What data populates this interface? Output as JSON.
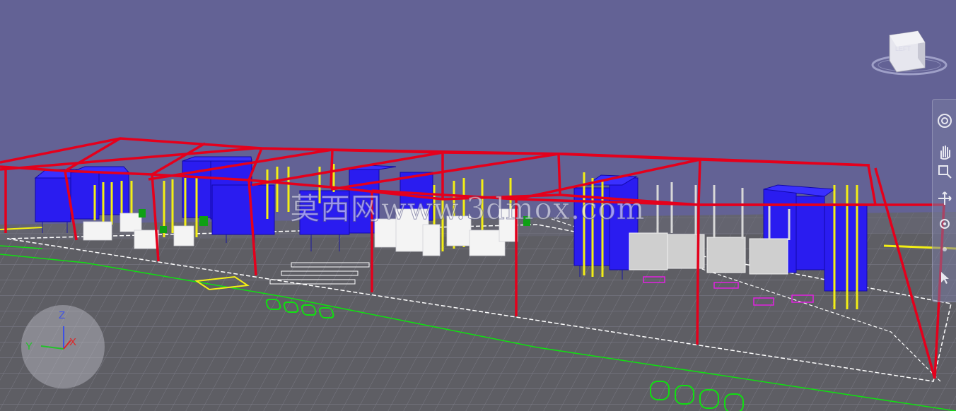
{
  "viewport": {
    "watermark_text": "莫西网www.3dmox.com",
    "colors": {
      "background": "#636295",
      "floor": "#5e5e64",
      "grid": "#7d7d88",
      "frame": "#e4001c",
      "dust_collector": "#2a1cf0",
      "elevator": "#f3ef14",
      "machine": "#ffffff",
      "outline": "#ffffff",
      "green_mark": "#10e010"
    }
  },
  "viewcube": {
    "face_label": "LEFT",
    "icon": "viewcube-icon"
  },
  "navigation_bar": {
    "tools": [
      {
        "name": "orbit-wheel",
        "icon": "steering-wheel-icon"
      },
      {
        "name": "pan",
        "icon": "hand-icon"
      },
      {
        "name": "zoom",
        "icon": "zoom-window-icon"
      },
      {
        "name": "orbit",
        "icon": "orbit-icon"
      },
      {
        "name": "look",
        "icon": "look-icon"
      },
      {
        "name": "walk",
        "icon": "walk-icon"
      },
      {
        "name": "select",
        "icon": "cursor-icon"
      }
    ]
  },
  "axis_gizmo": {
    "z_label": "Z",
    "y_label": "Y",
    "x_label": "X",
    "z_color": "#3c50e6",
    "y_color": "#22c22a",
    "x_color": "#e02424"
  }
}
